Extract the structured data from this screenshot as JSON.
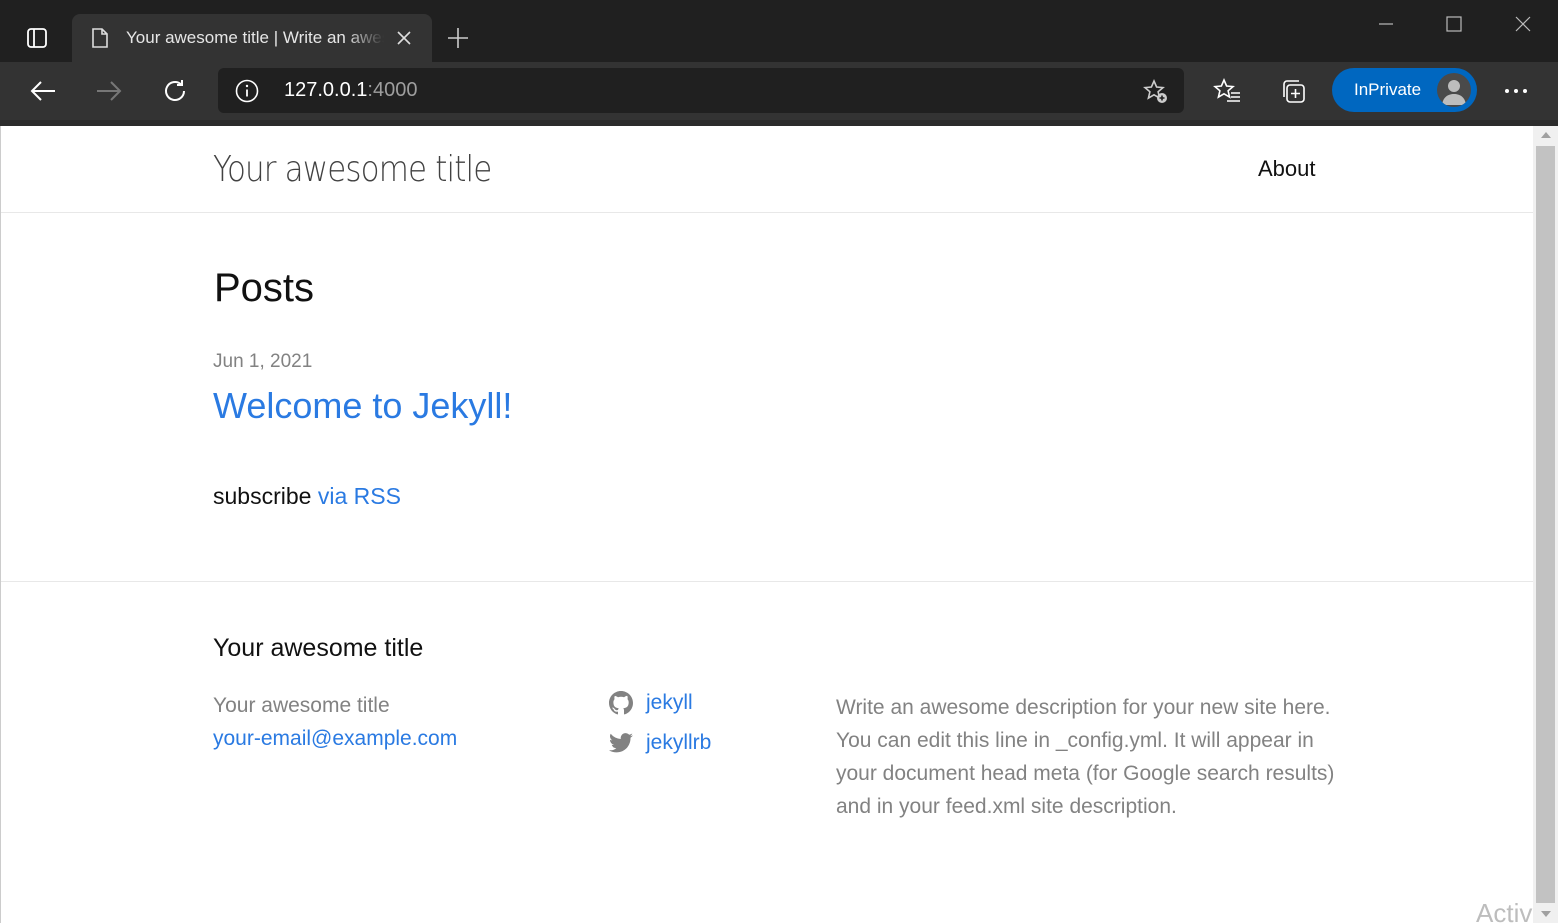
{
  "browser": {
    "tab_title": "Your awesome title | Write an awesome description for your new site here.",
    "url_host": "127.0.0.1",
    "url_port": ":4000",
    "inprivate_label": "InPrivate"
  },
  "page": {
    "site_title": "Your awesome title",
    "nav": [
      {
        "label": "About"
      }
    ],
    "heading": "Posts",
    "posts": [
      {
        "date": "Jun 1, 2021",
        "title": "Welcome to Jekyll!"
      }
    ],
    "subscribe_text": "subscribe ",
    "subscribe_link": "via RSS"
  },
  "footer": {
    "heading": "Your awesome title",
    "name": "Your awesome title",
    "email": "your-email@example.com",
    "social": [
      {
        "icon": "github-icon",
        "label": "jekyll"
      },
      {
        "icon": "twitter-icon",
        "label": "jekyllrb"
      }
    ],
    "description": "Write an awesome description for your new site here. You can edit this line in _config.yml. It will appear in your document head meta (for Google search results) and in your feed.xml site description."
  },
  "overlay": {
    "activate_text": "Activ"
  },
  "colors": {
    "link": "#2a7ae2",
    "inprivate": "#0067c0",
    "titlebar": "#202020",
    "toolbar": "#333333"
  }
}
